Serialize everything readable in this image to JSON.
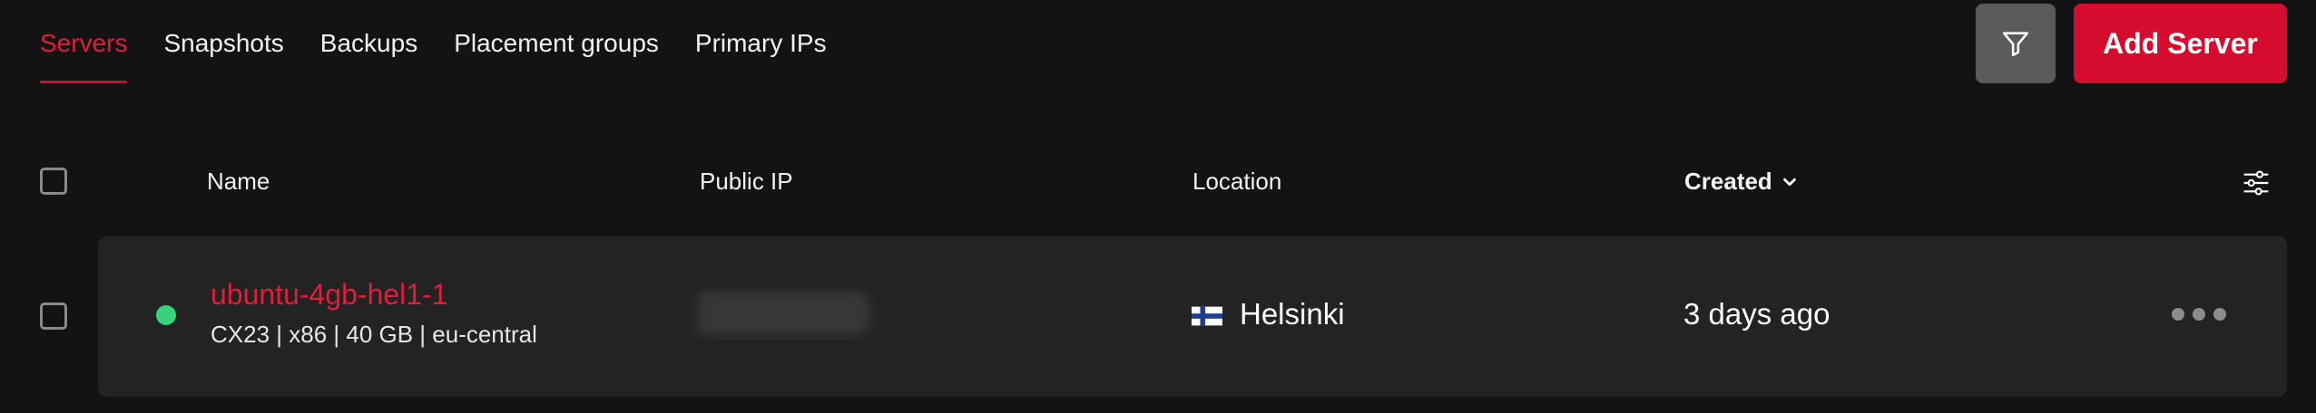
{
  "tabs": [
    {
      "label": "Servers"
    },
    {
      "label": "Snapshots"
    },
    {
      "label": "Backups"
    },
    {
      "label": "Placement groups"
    },
    {
      "label": "Primary IPs"
    }
  ],
  "actions": {
    "filter_icon": "filter-funnel-icon",
    "add_server_label": "Add Server"
  },
  "table": {
    "columns": {
      "name": "Name",
      "public_ip": "Public IP",
      "location": "Location",
      "created": "Created"
    },
    "rows": [
      {
        "status": "running",
        "status_color": "#36d37a",
        "name": "ubuntu-4gb-hel1-1",
        "meta": "CX23 | x86 | 40 GB | eu-central",
        "location": "Helsinki",
        "flag": "finland-flag-icon",
        "created": "3 days ago"
      }
    ]
  },
  "colors": {
    "background": "#131313",
    "row_background": "#232323",
    "accent": "#d50c2d",
    "accent_text": "#e11d3c"
  }
}
